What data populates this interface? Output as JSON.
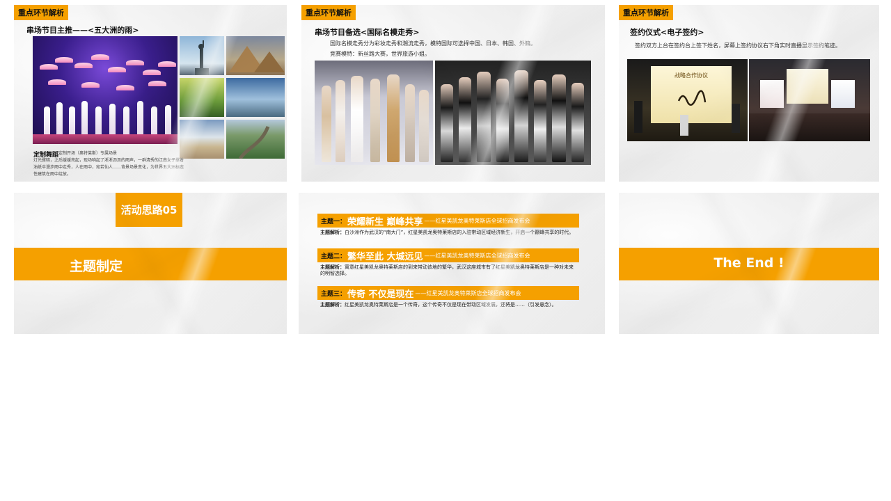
{
  "slides": {
    "s1": {
      "tag": "重点环节解析",
      "title": "串场节目主推——<五大洲的雨>",
      "caption_title": "定制舞蹈",
      "caption_sub": "定制开场（奥特莱斯）专属场景",
      "caption_lines": [
        "灯光骤暗，之后缓缓亮起，现场响起了淅淅沥沥的雨声，一群清秀的江南女子撑着",
        "油纸伞漫步雨中走秀，人在雨中，宛若仙人……背景场景变化，为世界五大洲标志",
        "性建筑在雨中绽放。"
      ]
    },
    "s2": {
      "tag": "重点环节解析",
      "title": "串场节目备选<国际名模走秀>",
      "line1": "国际名模走秀分为彩妆走秀和潮流走秀，模特国际可选择中国、日本、韩国、外籍。",
      "line2": "竞赛模特：新丝路大赛，世界旅游小姐。"
    },
    "s3": {
      "tag": "重点环节解析",
      "title": "签约仪式<电子签约>",
      "line1": "签约双方上台在签约台上签下姓名，屏幕上签约协议右下角实时直播显示签约笔迹。",
      "screen_text": "战略合作协议"
    },
    "s4": {
      "badge": "活动思路05",
      "band_title": "主题制定"
    },
    "s5": {
      "themes": [
        {
          "label": "主题一：",
          "title": "荣耀新生  巅峰共享",
          "sub": "——红星美凯龙奥特莱斯店全球招商发布会",
          "desc_label": "主题解析：",
          "desc": "白沙洲作为武汉的“南大门”，红星美凯龙奥特莱斯店的入驻带动区域经济新生，开启一个巅峰共享的时代。"
        },
        {
          "label": "主题二：",
          "title": "繁华至此  大城远见",
          "sub": "——红星美凯龙奥特莱斯店全球招商发布会",
          "desc_label": "主题解析：",
          "desc": "寓意红星美凯龙奥特莱斯店的到来带动该地的繁华，武汉这座城市有了红星美凯龙奥特莱斯店是一种对未来的明智选择。"
        },
        {
          "label": "主题三：",
          "title": "传奇  不仅是现在",
          "sub": "——红星美凯龙奥特莱斯店全球招商发布会",
          "desc_label": "主题解析：",
          "desc": "红星美凯龙奥特莱斯店是一个传奇，这个传奇不仅是现在带动区域发展，还将是……（引发悬念）。"
        }
      ]
    },
    "s6": {
      "band_title": "The  End !"
    }
  },
  "colors": {
    "accent": "#f5a000",
    "slide_bg": "#f0f0f0"
  }
}
